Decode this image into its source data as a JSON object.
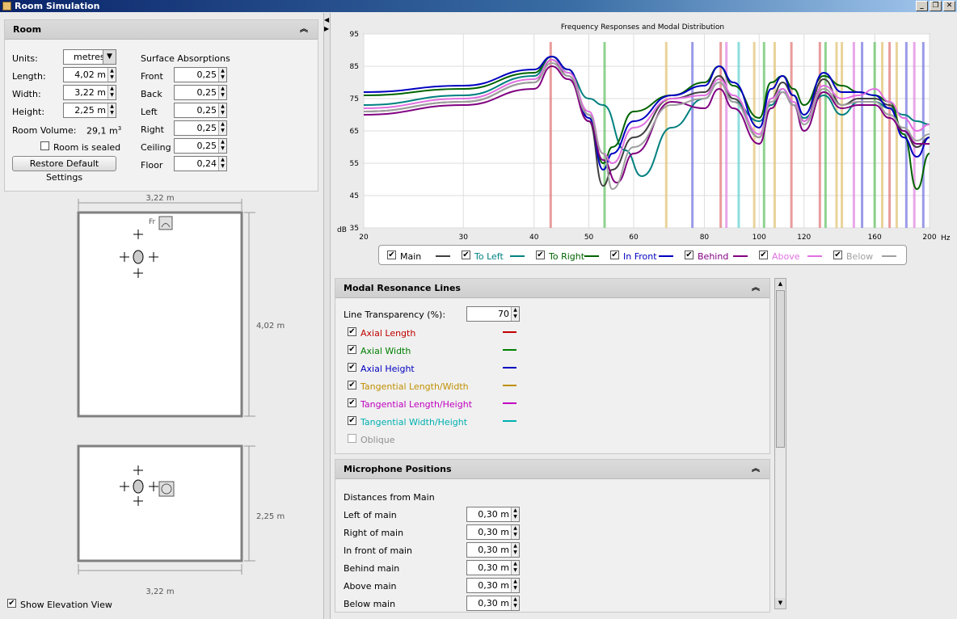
{
  "window": {
    "title": "Room Simulation"
  },
  "room": {
    "title": "Room",
    "units_label": "Units:",
    "units_value": "metres",
    "length_label": "Length:",
    "length_value": "4,02 m",
    "width_label": "Width:",
    "width_value": "3,22 m",
    "height_label": "Height:",
    "height_value": "2,25 m",
    "volume_label": "Room Volume:",
    "volume_value": "29,1 m",
    "volume_unit_sup": "3",
    "sealed_label": "Room is sealed",
    "sealed_checked": false,
    "restore_button": "Restore Default Settings",
    "surface_title": "Surface Absorptions",
    "surfaces": [
      {
        "label": "Front",
        "value": "0,25"
      },
      {
        "label": "Back",
        "value": "0,25"
      },
      {
        "label": "Left",
        "value": "0,25"
      },
      {
        "label": "Right",
        "value": "0,25"
      },
      {
        "label": "Ceiling",
        "value": "0,25"
      },
      {
        "label": "Floor",
        "value": "0,24"
      }
    ]
  },
  "plan": {
    "top_width_dim": "3,22 m",
    "length_dim": "4,02 m",
    "height_dim": "2,25 m",
    "bottom_width_dim": "3,22 m",
    "speaker_label": "Fr",
    "elevation_label": "Show Elevation View",
    "elevation_checked": true
  },
  "chart_data": {
    "type": "line",
    "title": "Frequency Responses and Modal Distribution",
    "ylabel": "dB",
    "xunit": "Hz",
    "ylim": [
      35,
      95
    ],
    "xlim": [
      20,
      200
    ],
    "xscale": "log",
    "yticks": [
      35,
      45,
      55,
      65,
      75,
      85,
      95
    ],
    "xticks": [
      20,
      30,
      40,
      50,
      60,
      80,
      100,
      120,
      160,
      200
    ],
    "grid": true,
    "series": [
      {
        "name": "Main",
        "color": "#404040",
        "x": [
          20,
          30,
          40,
          43,
          46,
          50,
          53,
          55,
          60,
          70,
          80,
          85,
          90,
          100,
          105,
          110,
          115,
          120,
          130,
          140,
          150,
          160,
          170,
          180,
          190,
          200
        ],
        "y": [
          71,
          74,
          80,
          87,
          82,
          68,
          48,
          53,
          63,
          75,
          77,
          82,
          75,
          63,
          75,
          80,
          76,
          68,
          81,
          73,
          75,
          75,
          73,
          65,
          60,
          63
        ]
      },
      {
        "name": "To Left",
        "color": "#008080",
        "x": [
          20,
          30,
          40,
          43,
          46,
          50,
          53,
          58,
          62,
          70,
          80,
          85,
          90,
          100,
          105,
          110,
          115,
          120,
          130,
          140,
          150,
          160,
          170,
          180,
          190,
          200
        ],
        "y": [
          73,
          76,
          82,
          88,
          83,
          75,
          73,
          59,
          51,
          66,
          75,
          80,
          74,
          68,
          73,
          78,
          73,
          69,
          76,
          70,
          74,
          74,
          72,
          70,
          68,
          67
        ]
      },
      {
        "name": "To Right",
        "color": "#006400",
        "x": [
          20,
          30,
          40,
          43,
          46,
          50,
          53,
          55,
          60,
          70,
          80,
          85,
          90,
          100,
          105,
          110,
          115,
          120,
          130,
          140,
          150,
          160,
          170,
          180,
          190,
          200
        ],
        "y": [
          76,
          78,
          83,
          88,
          84,
          70,
          55,
          60,
          71,
          76,
          80,
          85,
          79,
          69,
          80,
          82,
          78,
          73,
          82,
          79,
          77,
          76,
          74,
          64,
          47,
          58
        ]
      },
      {
        "name": "In Front",
        "color": "#0000c0",
        "x": [
          20,
          30,
          40,
          43,
          46,
          50,
          53,
          55,
          60,
          70,
          80,
          85,
          90,
          100,
          105,
          110,
          115,
          120,
          130,
          140,
          150,
          160,
          170,
          180,
          190,
          200
        ],
        "y": [
          77,
          79,
          84,
          88,
          84,
          69,
          53,
          58,
          68,
          76,
          79,
          85,
          80,
          66,
          78,
          82,
          76,
          70,
          83,
          77,
          77,
          76,
          72,
          63,
          57,
          63
        ]
      },
      {
        "name": "Behind",
        "color": "#800080",
        "x": [
          20,
          30,
          40,
          43,
          46,
          50,
          53,
          56,
          60,
          70,
          80,
          85,
          90,
          100,
          105,
          110,
          115,
          120,
          130,
          140,
          150,
          160,
          170,
          180,
          190,
          200
        ],
        "y": [
          70,
          73,
          78,
          85,
          81,
          68,
          56,
          49,
          58,
          74,
          72,
          78,
          72,
          61,
          72,
          77,
          73,
          65,
          77,
          72,
          73,
          73,
          69,
          65,
          61,
          61
        ]
      },
      {
        "name": "Above",
        "color": "#e070e0",
        "x": [
          20,
          30,
          40,
          43,
          46,
          50,
          53,
          55,
          60,
          70,
          80,
          85,
          90,
          100,
          105,
          110,
          115,
          120,
          130,
          140,
          150,
          160,
          170,
          180,
          190,
          200
        ],
        "y": [
          72,
          75,
          81,
          87,
          83,
          71,
          58,
          55,
          66,
          75,
          76,
          81,
          76,
          64,
          75,
          78,
          74,
          68,
          79,
          75,
          76,
          78,
          74,
          69,
          65,
          67
        ]
      },
      {
        "name": "Below",
        "color": "#a0a0a0",
        "x": [
          20,
          30,
          40,
          43,
          46,
          50,
          53,
          55,
          60,
          70,
          80,
          85,
          90,
          100,
          105,
          110,
          115,
          120,
          130,
          140,
          150,
          160,
          170,
          180,
          190,
          200
        ],
        "y": [
          71,
          74,
          80,
          86,
          82,
          70,
          58,
          47,
          60,
          73,
          75,
          80,
          74,
          63,
          74,
          77,
          73,
          67,
          78,
          73,
          74,
          74,
          70,
          66,
          62,
          64
        ]
      }
    ],
    "modal_lines": [
      {
        "f": 42.8,
        "color": "#e07070"
      },
      {
        "f": 53.3,
        "color": "#60c060"
      },
      {
        "f": 68.5,
        "color": "#e0c070"
      },
      {
        "f": 76.2,
        "color": "#7070e0"
      },
      {
        "f": 85.5,
        "color": "#e07070"
      },
      {
        "f": 87.5,
        "color": "#e080e0"
      },
      {
        "f": 92.0,
        "color": "#60d0d0"
      },
      {
        "f": 98.0,
        "color": "#e0c070"
      },
      {
        "f": 102.0,
        "color": "#60c060"
      },
      {
        "f": 106.5,
        "color": "#e0c070"
      },
      {
        "f": 114.0,
        "color": "#e07070"
      },
      {
        "f": 128.0,
        "color": "#e07070"
      },
      {
        "f": 131.0,
        "color": "#60c060"
      },
      {
        "f": 137.0,
        "color": "#e0c070"
      },
      {
        "f": 140.0,
        "color": "#e0c070"
      },
      {
        "f": 147.0,
        "color": "#e080e0"
      },
      {
        "f": 152.0,
        "color": "#7070e0"
      },
      {
        "f": 160.0,
        "color": "#60c060"
      },
      {
        "f": 165.0,
        "color": "#e0c070"
      },
      {
        "f": 170.0,
        "color": "#e07070"
      },
      {
        "f": 175.0,
        "color": "#e0c070"
      },
      {
        "f": 182.0,
        "color": "#7070e0"
      },
      {
        "f": 188.0,
        "color": "#e080e0"
      },
      {
        "f": 195.0,
        "color": "#7070e0"
      }
    ]
  },
  "modal": {
    "title": "Modal Resonance Lines",
    "transparency_label": "Line Transparency (%):",
    "transparency_value": "70",
    "lines": [
      {
        "label": "Axial Length",
        "color": "#c00000",
        "text_color": "#c00000",
        "checked": true
      },
      {
        "label": "Axial Width",
        "color": "#008000",
        "text_color": "#008000",
        "checked": true
      },
      {
        "label": "Axial Height",
        "color": "#0000c0",
        "text_color": "#0000c0",
        "checked": true
      },
      {
        "label": "Tangential Length/Width",
        "color": "#c09000",
        "text_color": "#c09000",
        "checked": true
      },
      {
        "label": "Tangential Length/Height",
        "color": "#c000c0",
        "text_color": "#c000c0",
        "checked": true
      },
      {
        "label": "Tangential Width/Height",
        "color": "#00b0b0",
        "text_color": "#00b0b0",
        "checked": true
      },
      {
        "label": "Oblique",
        "color": "",
        "text_color": "#909090",
        "checked": false
      }
    ]
  },
  "mic": {
    "title": "Microphone Positions",
    "subtitle": "Distances from Main",
    "rows": [
      {
        "label": "Left of main",
        "value": "0,30 m"
      },
      {
        "label": "Right of main",
        "value": "0,30 m"
      },
      {
        "label": "In front of main",
        "value": "0,30 m"
      },
      {
        "label": "Behind main",
        "value": "0,30 m"
      },
      {
        "label": "Above main",
        "value": "0,30 m"
      },
      {
        "label": "Below main",
        "value": "0,30 m"
      }
    ]
  },
  "icons": {
    "collapse": "double-chevron-up-icon",
    "spinner": "spinner-arrows-icon",
    "dropdown": "triangle-down-icon"
  }
}
